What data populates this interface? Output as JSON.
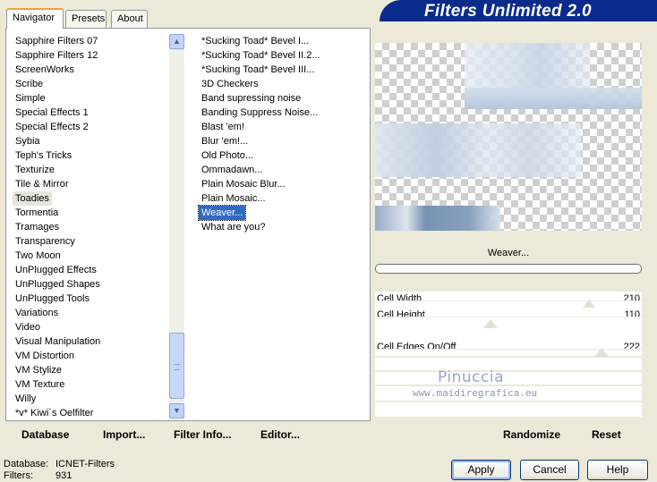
{
  "banner": {
    "title": "Filters Unlimited 2.0"
  },
  "tabs": [
    {
      "label": "Navigator",
      "active": true
    },
    {
      "label": "Presets",
      "active": false
    },
    {
      "label": "About",
      "active": false
    }
  ],
  "categories": {
    "items": [
      "Sapphire Filters 07",
      "Sapphire Filters 12",
      "ScreenWorks",
      "Scribe",
      "Simple",
      "Special Effects 1",
      "Special Effects 2",
      "Sybia",
      "Teph's Tricks",
      "Texturize",
      "Tile & Mirror",
      "Toadies",
      "Tormentia",
      "Tramages",
      "Transparency",
      "Two Moon",
      "UnPlugged Effects",
      "UnPlugged Shapes",
      "UnPlugged Tools",
      "Variations",
      "Video",
      "Visual Manipulation",
      "VM Distortion",
      "VM Stylize",
      "VM Texture",
      "Willy",
      "*v* Kiwi`s Oelfilter"
    ],
    "selected": "Toadies"
  },
  "filters": {
    "items": [
      "*Sucking Toad*  Bevel I...",
      "*Sucking Toad*  Bevel II.2...",
      "*Sucking Toad*  Bevel III...",
      "3D Checkers",
      "Band supressing noise",
      "Banding Suppress Noise...",
      "Blast 'em!",
      "Blur 'em!...",
      "Old Photo...",
      "Ommadawn...",
      "Plain Mosaic Blur...",
      "Plain Mosaic...",
      "Weaver...",
      "What are you?"
    ],
    "selected": "Weaver..."
  },
  "filter_name": "Weaver...",
  "params": [
    {
      "label": "Cell Width",
      "value": "210"
    },
    {
      "label": "Cell Height",
      "value": "110"
    },
    {
      "label": "Cell Edges On/Off",
      "value": "222"
    }
  ],
  "slider_levels": [
    0.82,
    0.43,
    0.87
  ],
  "watermark": {
    "name": "Pinuccia",
    "url": "www.maidiregrafica.eu"
  },
  "bottom_buttons": {
    "database": "Database",
    "import": "Import...",
    "filter_info": "Filter Info...",
    "editor": "Editor...",
    "randomize": "Randomize",
    "reset": "Reset"
  },
  "footer": {
    "database_label": "Database:",
    "database_value": "ICNET-Filters",
    "filters_label": "Filters:",
    "filters_value": "931"
  },
  "dialog_buttons": {
    "apply": "Apply",
    "cancel": "Cancel",
    "help": "Help"
  }
}
